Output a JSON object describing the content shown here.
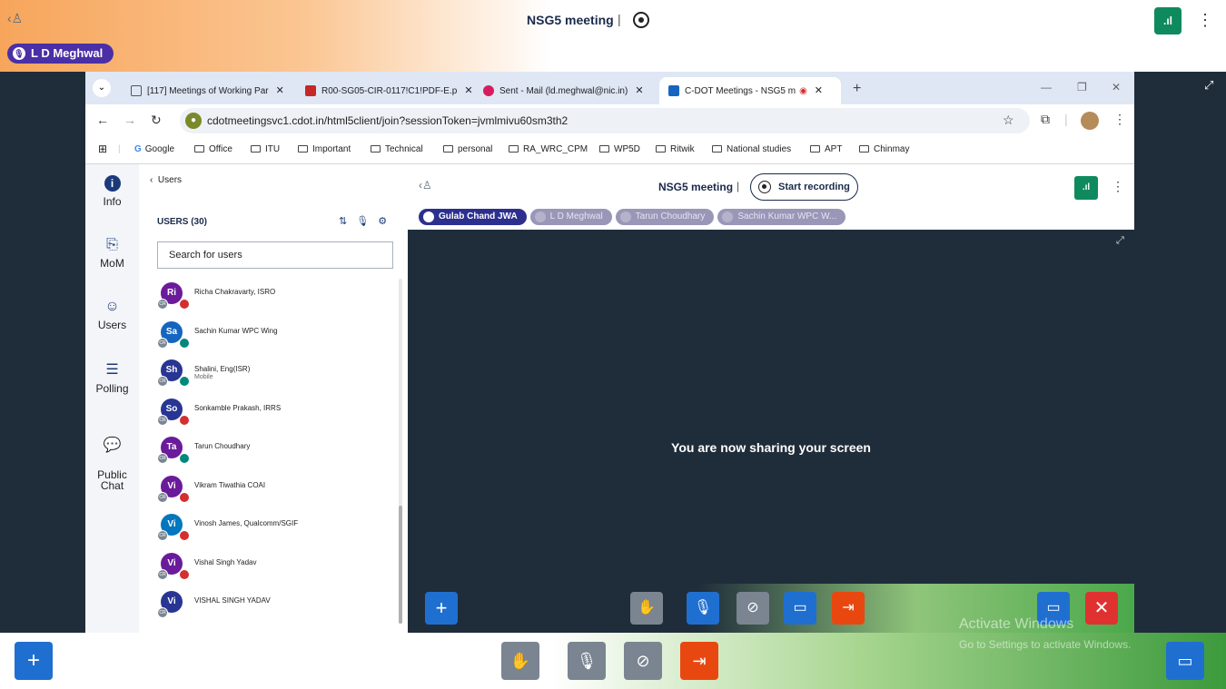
{
  "outer": {
    "title": "NSG5 meeting",
    "separator": "|",
    "speaker": "L D Meghwal",
    "signal": ".ıl",
    "kebab": "⋮"
  },
  "tabs": [
    {
      "label": "[117] Meetings of Working Par",
      "color": "#555"
    },
    {
      "label": "R00-SG05-CIR-0117!C1!PDF-E.p",
      "color": "#c62828"
    },
    {
      "label": "Sent - Mail (ld.meghwal@nic.in)",
      "color": "#d81b60"
    },
    {
      "label": "C-DOT Meetings - NSG5 m",
      "color": "#1565c0"
    }
  ],
  "url": "cdotmeetingsvc1.cdot.in/html5client/join?sessionToken=jvmlmivu60sm3th2",
  "bookmarks": [
    "Google",
    "Office",
    "ITU",
    "Important",
    "Technical",
    "personal",
    "RA_WRC_CPM",
    "WP5D",
    "Ritwik",
    "National studies",
    "APT",
    "Chinmay"
  ],
  "nav": [
    {
      "label": "Info",
      "icon": "i"
    },
    {
      "label": "MoM",
      "icon": "⎘"
    },
    {
      "label": "Users",
      "icon": "☺"
    },
    {
      "label": "Polling",
      "icon": "☰"
    },
    {
      "label": "Public\nChat",
      "icon": "💬"
    }
  ],
  "users_panel": {
    "back_label": "Users",
    "count_label": "USERS (30)",
    "search_placeholder": "Search for users"
  },
  "users": [
    {
      "initials": "Ri",
      "name": "Richa Chakravarty, ISRO",
      "sub": "",
      "color": "#6a1b9a",
      "badge": "#d32f2f"
    },
    {
      "initials": "Sa",
      "name": "Sachin Kumar WPC Wing",
      "sub": "",
      "color": "#1565c0",
      "badge": "#00897b"
    },
    {
      "initials": "Sh",
      "name": "Shalini, Eng(ISR)",
      "sub": "Mobile",
      "color": "#283593",
      "badge": "#00897b"
    },
    {
      "initials": "So",
      "name": "Sonkamble Prakash, IRRS",
      "sub": "",
      "color": "#283593",
      "badge": "#d32f2f"
    },
    {
      "initials": "Ta",
      "name": "Tarun Choudhary",
      "sub": "",
      "color": "#6a1b9a",
      "badge": "#00897b"
    },
    {
      "initials": "Vi",
      "name": "Vikram Tiwathia COAI",
      "sub": "",
      "color": "#6a1b9a",
      "badge": "#d32f2f"
    },
    {
      "initials": "Vi",
      "name": "Vinosh James, Qualcomm/SGIF",
      "sub": "",
      "color": "#0277bd",
      "badge": "#d32f2f"
    },
    {
      "initials": "Vi",
      "name": "Vishal Singh Yadav",
      "sub": "",
      "color": "#6a1b9a",
      "badge": "#d32f2f"
    },
    {
      "initials": "Vi",
      "name": "VISHAL SINGH YADAV",
      "sub": "",
      "color": "#283593",
      "badge": "#ffffff"
    }
  ],
  "inner": {
    "title": "NSG5 meeting",
    "separator": "|",
    "record_label": "Start recording",
    "talkers": [
      "Gulab Chand JWA",
      "L D Meghwal",
      "Tarun Choudhary",
      "Sachin Kumar WPC W..."
    ],
    "screen_message": "You are now sharing your screen"
  },
  "watermark": {
    "title": "Activate Windows",
    "subtitle": "Go to Settings to activate Windows."
  },
  "colors": {
    "accent": "#1b3a7a",
    "action_blue": "#1f6fd1",
    "leave_orange": "#e8480f",
    "gray_btn": "#7a8591",
    "close_red": "#e03131"
  }
}
